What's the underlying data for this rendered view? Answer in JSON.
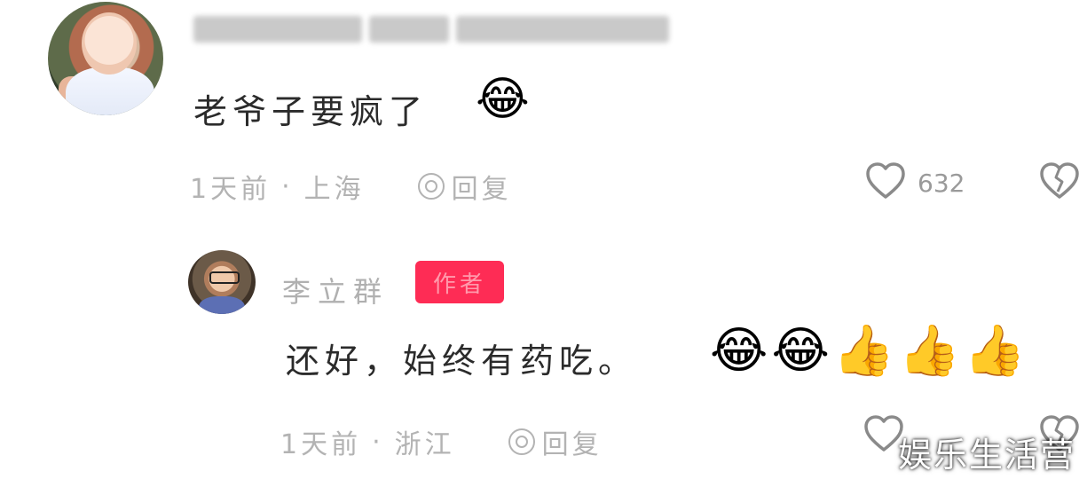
{
  "comments": [
    {
      "text": "老爷子要疯了",
      "emoji": "😂",
      "time": "1天前",
      "location": "上海",
      "reply_label": "回复",
      "like_count": "632"
    }
  ],
  "reply": {
    "author_name": "李立群",
    "author_badge": "作者",
    "text": "还好，始终有药吃。",
    "emojis": [
      "😂",
      "😂",
      "👍",
      "👍",
      "👍"
    ],
    "time": "1天前",
    "location": "浙江",
    "reply_label": "回复"
  },
  "separator": "·",
  "watermark": "娱乐生活营",
  "icons": [
    "heart-outline-icon",
    "broken-heart-icon",
    "reply-icon"
  ],
  "colors": {
    "badge": "#fe2c55",
    "meta": "#b3b3b3",
    "text": "#2b2b2b"
  }
}
